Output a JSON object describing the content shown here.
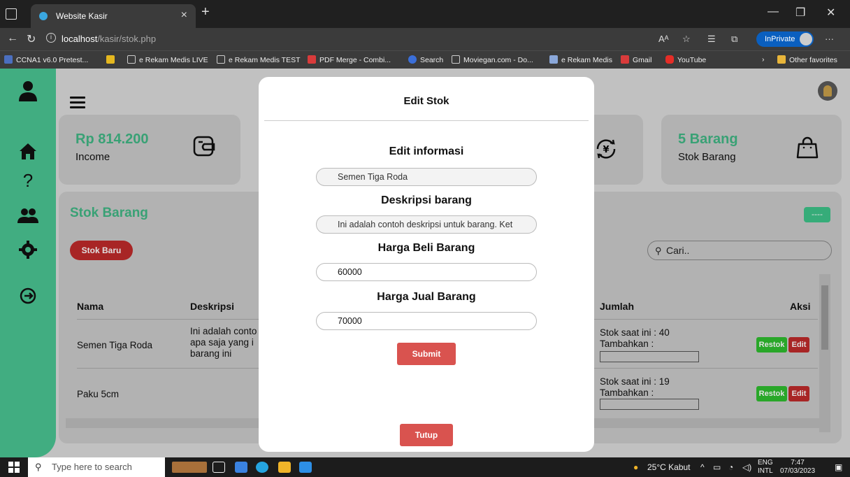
{
  "browser": {
    "tab_title": "Website Kasir",
    "url_host": "localhost",
    "url_path": "/kasir/stok.php",
    "inprivate_label": "InPrivate",
    "favorites": [
      "CCNA1 v6.0 Pretest...",
      "e Rekam Medis LIVE",
      "e Rekam Medis TEST",
      "PDF Merge - Combi...",
      "Search",
      "Moviegan.com - Do...",
      "e Rekam Medis",
      "Gmail",
      "YouTube"
    ],
    "other_favorites": "Other favorites"
  },
  "cards": {
    "income_amount": "Rp 814.200",
    "income_label": "Income",
    "stok_amount": "5 Barang",
    "stok_label": "Stok Barang"
  },
  "panel": {
    "title": "Stok Barang",
    "new_button": "Stok Baru",
    "top_button": "----",
    "search_placeholder": "Cari..",
    "columns": [
      "Nama",
      "Deskripsi",
      "Jumlah",
      "Aksi"
    ],
    "rows": [
      {
        "nama": "Semen Tiga Roda",
        "desc_lines": [
          "Ini adalah conto",
          "apa saja yang i",
          "barang ini"
        ],
        "stok": "Stok saat ini : 40",
        "tambah": "Tambahkan :"
      },
      {
        "nama": "Paku 5cm",
        "desc_lines": [
          "",
          "",
          ""
        ],
        "stok": "Stok saat ini : 19",
        "tambah": "Tambahkan :"
      }
    ],
    "restok_label": "Restok",
    "edit_label": "Edit"
  },
  "modal": {
    "title": "Edit Stok",
    "label_info": "Edit informasi",
    "value_nama": "Semen Tiga Roda",
    "label_desc": "Deskripsi barang",
    "value_desc": "Ini adalah contoh deskripsi untuk barang. Ket",
    "label_beli": "Harga Beli Barang",
    "value_beli": "60000",
    "label_jual": "Harga Jual Barang",
    "value_jual": "70000",
    "submit_label": "Submit",
    "close_label": "Tutup"
  },
  "taskbar": {
    "search_placeholder": "Type here to search",
    "weather": "25°C  Kabut",
    "lang_top": "ENG",
    "lang_bottom": "INTL",
    "time": "7:47",
    "date": "07/03/2023"
  },
  "colors": {
    "accent_green": "#4bc593",
    "danger_red": "#c02b2b",
    "modal_button": "#d9534f"
  }
}
